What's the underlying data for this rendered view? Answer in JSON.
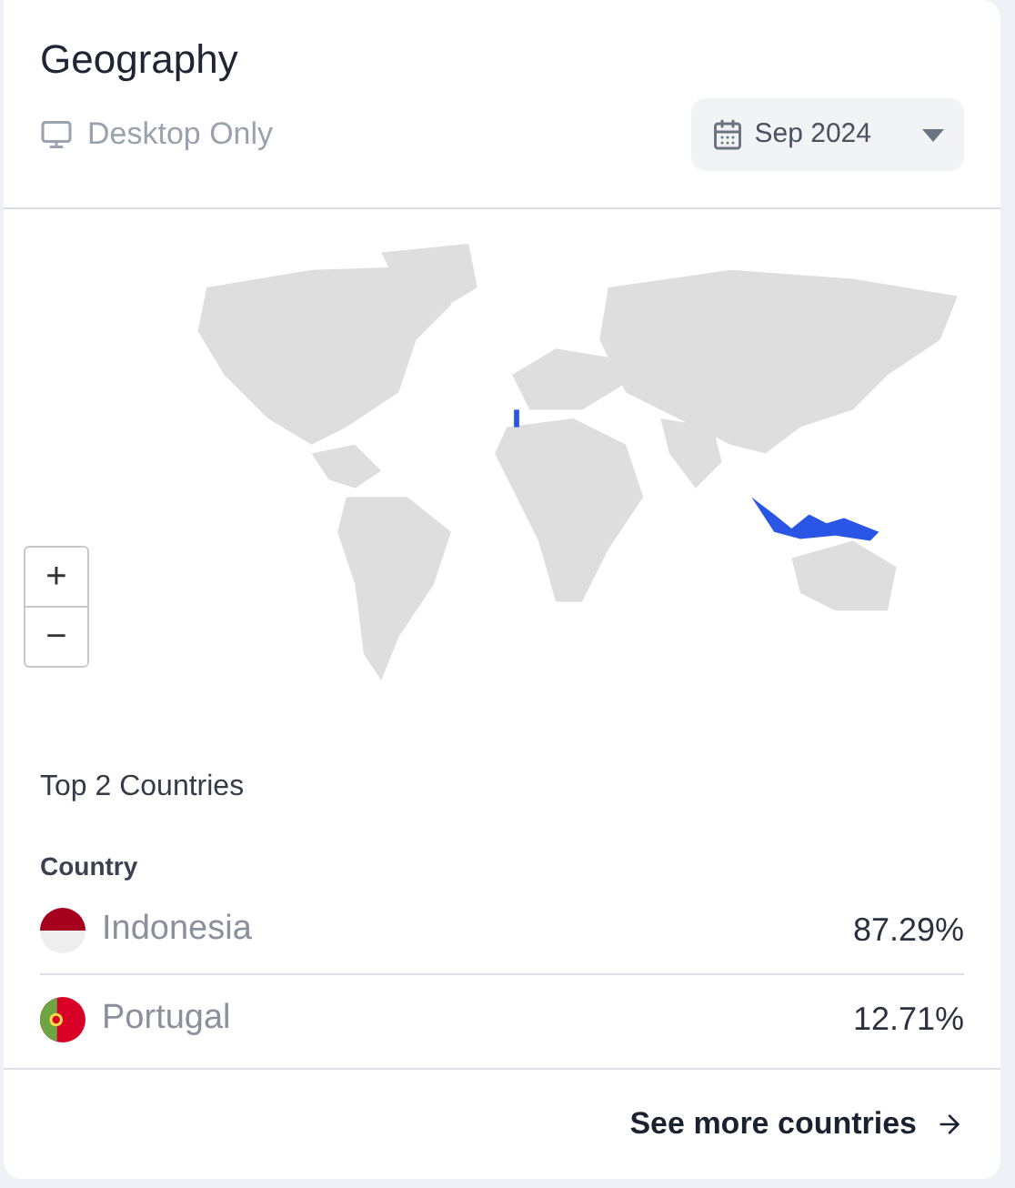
{
  "title": "Geography",
  "device_filter": "Desktop Only",
  "date_picker": {
    "value": "Sep 2024"
  },
  "map": {
    "zoom_controls": [
      "+",
      "−"
    ]
  },
  "top_heading": "Top 2 Countries",
  "column_header": "Country",
  "countries": [
    {
      "name": "Indonesia",
      "share": "87.29%",
      "kind": "bicolor"
    },
    {
      "name": "Portugal",
      "share": "12.71%",
      "kind": "shield"
    }
  ],
  "footer_link": "See more countries"
}
